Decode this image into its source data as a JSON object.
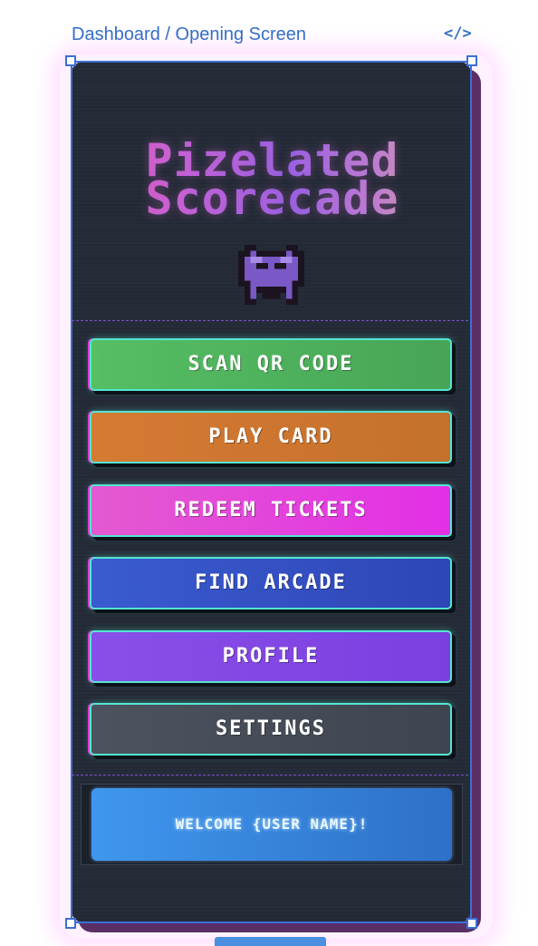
{
  "frame": {
    "label": "Dashboard / Opening Screen",
    "code_icon": "</>"
  },
  "app": {
    "title_line1": "Pizelated",
    "title_line2": "Scorecade",
    "mascot_icon": "space-invader-icon"
  },
  "menu": {
    "items": [
      {
        "label": "SCAN QR CODE",
        "color": "#4fb35d"
      },
      {
        "label": "PLAY CARD",
        "color": "#cf7630"
      },
      {
        "label": "REDEEM TICKETS",
        "color": "#e43fe0"
      },
      {
        "label": "FIND ARCADE",
        "color": "#3352c4"
      },
      {
        "label": "PROFILE",
        "color": "#7c47e6"
      },
      {
        "label": "SETTINGS",
        "color": "#464d59"
      }
    ]
  },
  "welcome": {
    "label": "WELCOME {USER NAME}!"
  },
  "colors": {
    "accent_border": "#53e6d2",
    "accent_shadow": "#e23bd3",
    "background": "#232a36",
    "selection": "#3b6fd8"
  }
}
